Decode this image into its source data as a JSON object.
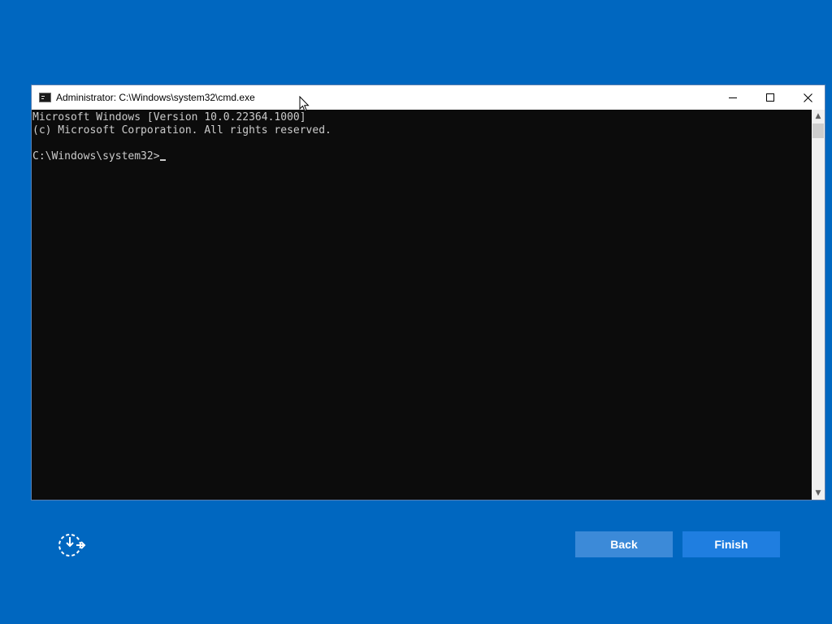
{
  "window": {
    "title": "Administrator: C:\\Windows\\system32\\cmd.exe",
    "minimize_icon": "minimize-icon",
    "maximize_icon": "maximize-icon",
    "close_icon": "close-icon"
  },
  "console": {
    "lines": [
      "Microsoft Windows [Version 10.0.22364.1000]",
      "(c) Microsoft Corporation. All rights reserved.",
      "",
      "C:\\Windows\\system32>"
    ]
  },
  "scrollbar": {
    "up_glyph": "▲",
    "down_glyph": "▼"
  },
  "footer": {
    "accessibility_icon": "accessibility-icon",
    "back_label": "Back",
    "finish_label": "Finish"
  },
  "colors": {
    "background": "#0067c0",
    "console_bg": "#0c0c0c",
    "console_text": "#cccccc",
    "button_back": "#3c8ad8",
    "button_finish": "#1f7ee0"
  }
}
